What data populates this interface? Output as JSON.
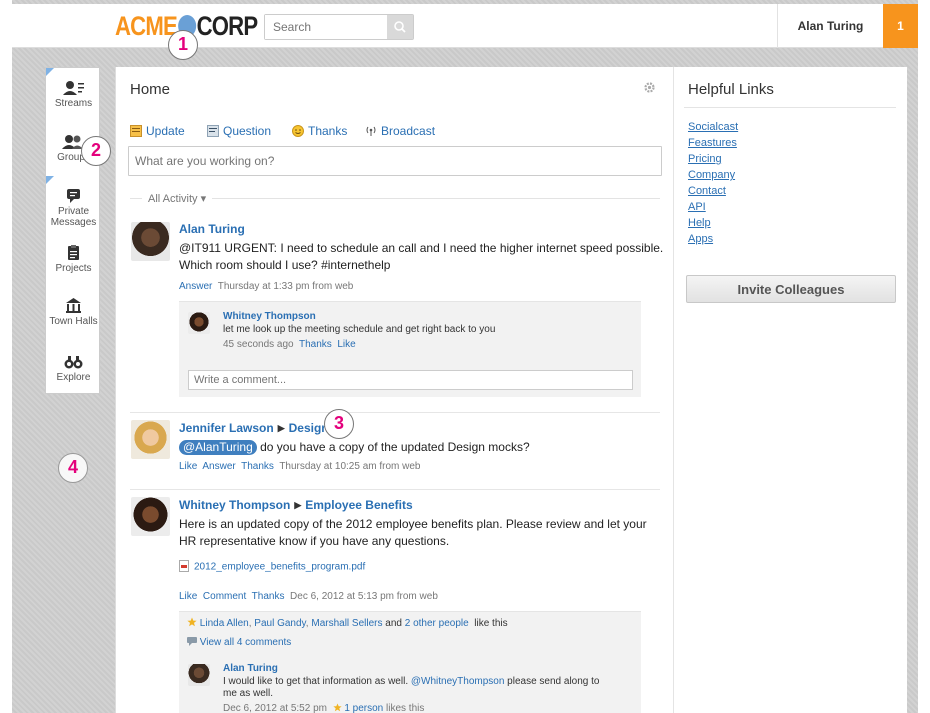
{
  "header": {
    "logo_left": "ACME",
    "logo_right": "CORP",
    "search_placeholder": "Search",
    "user_name": "Alan Turing",
    "notification_count": "1",
    "colors": {
      "brand_orange": "#f7941d",
      "link_blue": "#2a6fb3"
    }
  },
  "sidebar": {
    "items": [
      {
        "label": "Streams",
        "icon": "streams-icon"
      },
      {
        "label": "Groups",
        "icon": "groups-icon"
      },
      {
        "label": "Private Messages",
        "icon": "private-messages-icon"
      },
      {
        "label": "Projects",
        "icon": "projects-icon"
      },
      {
        "label": "Town Halls",
        "icon": "town-halls-icon"
      },
      {
        "label": "Explore",
        "icon": "explore-icon"
      }
    ]
  },
  "main": {
    "title": "Home",
    "tabs": [
      {
        "label": "Update",
        "icon": "update-icon"
      },
      {
        "label": "Question",
        "icon": "question-icon"
      },
      {
        "label": "Thanks",
        "icon": "thanks-icon"
      },
      {
        "label": "Broadcast",
        "icon": "broadcast-icon"
      }
    ],
    "publisher_placeholder": "What are you working on?",
    "filter_label": "All Activity ▾",
    "posts": [
      {
        "author": "Alan Turing",
        "text_line1": "@IT911 URGENT: I need to schedule an call and I need the higher internet speed possible.",
        "text_line2": "Which room should I use? #internethelp",
        "actions": [
          "Answer"
        ],
        "meta": "Thursday at 1:33 pm from web",
        "comments": [
          {
            "author": "Whitney Thompson",
            "text": "let me look up the meeting schedule and get right back to you",
            "meta": "45 seconds ago",
            "actions": [
              "Thanks",
              "Like"
            ]
          }
        ],
        "comment_placeholder": "Write a comment..."
      },
      {
        "author": "Jennifer Lawson",
        "group": "Design",
        "mention": "@AlanTuring",
        "text": " do you have a copy of the updated Design mocks?",
        "actions": [
          "Like",
          "Answer",
          "Thanks"
        ],
        "meta": "Thursday at 10:25 am from web"
      },
      {
        "author": "Whitney Thompson",
        "group": "Employee Benefits",
        "text_line1": "Here is an updated copy of the 2012 employee benefits plan. Please review and let your",
        "text_line2": "HR representative know if you have any questions.",
        "attachment": "2012_employee_benefits_program.pdf",
        "actions": [
          "Like",
          "Comment",
          "Thanks"
        ],
        "meta": "Dec 6, 2012 at 5:13 pm from web",
        "likers": [
          "Linda Allen",
          "Paul Gandy",
          "Marshall Sellers"
        ],
        "likers_and": "and",
        "likers_others": "2 other people",
        "likers_suffix": "like this",
        "view_all": "View all 4 comments",
        "comment": {
          "author": "Alan Turing",
          "text_before": "I would like to get that information as well. ",
          "mention": "@WhitneyThompson",
          "text_after": " please send along to",
          "text_line2": "me as well.",
          "meta": "Dec 6, 2012 at 5:52 pm",
          "likes_link": "1 person",
          "likes_suffix": "likes this"
        }
      }
    ]
  },
  "right": {
    "title": "Helpful Links",
    "links": [
      "Socialcast",
      "Feastures",
      "Pricing",
      "Company",
      "Contact",
      "API",
      "Help",
      "Apps"
    ],
    "invite_label": "Invite Colleagues"
  },
  "markers": [
    "1",
    "2",
    "3",
    "4"
  ]
}
